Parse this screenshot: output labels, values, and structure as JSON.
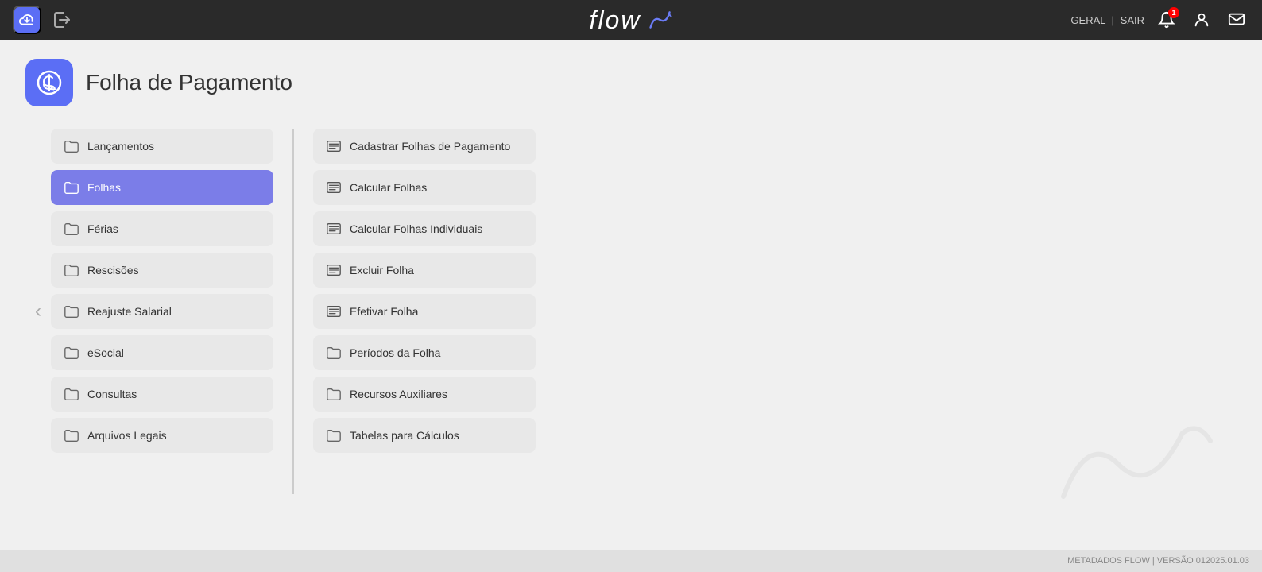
{
  "app": {
    "title": "flow",
    "brand_icon": "flow-icon"
  },
  "topnav": {
    "links": {
      "geral": "GERAL",
      "separator": "|",
      "sair": "SAIR"
    },
    "notif_count": "1"
  },
  "page": {
    "title": "Folha de Pagamento"
  },
  "col1": {
    "items": [
      {
        "id": "lancamentos",
        "label": "Lançamentos",
        "icon": "folder",
        "active": false
      },
      {
        "id": "folhas",
        "label": "Folhas",
        "icon": "folder",
        "active": true
      },
      {
        "id": "ferias",
        "label": "Férias",
        "icon": "folder",
        "active": false
      },
      {
        "id": "rescisoes",
        "label": "Rescisões",
        "icon": "folder",
        "active": false
      },
      {
        "id": "reajuste-salarial",
        "label": "Reajuste Salarial",
        "icon": "folder",
        "active": false
      },
      {
        "id": "esocial",
        "label": "eSocial",
        "icon": "folder",
        "active": false
      },
      {
        "id": "consultas",
        "label": "Consultas",
        "icon": "folder",
        "active": false
      },
      {
        "id": "arquivos-legais",
        "label": "Arquivos Legais",
        "icon": "folder",
        "active": false
      }
    ]
  },
  "col2": {
    "items": [
      {
        "id": "cadastrar-folhas",
        "label": "Cadastrar Folhas de Pagamento",
        "icon": "list"
      },
      {
        "id": "calcular-folhas",
        "label": "Calcular Folhas",
        "icon": "list"
      },
      {
        "id": "calcular-folhas-ind",
        "label": "Calcular Folhas Individuais",
        "icon": "list"
      },
      {
        "id": "excluir-folha",
        "label": "Excluir Folha",
        "icon": "list"
      },
      {
        "id": "efetivar-folha",
        "label": "Efetivar Folha",
        "icon": "list"
      },
      {
        "id": "periodos-folha",
        "label": "Períodos da Folha",
        "icon": "folder"
      },
      {
        "id": "recursos-auxiliares",
        "label": "Recursos Auxiliares",
        "icon": "folder"
      },
      {
        "id": "tabelas-calculos",
        "label": "Tabelas para Cálculos",
        "icon": "folder"
      }
    ]
  },
  "footer": {
    "text": "METADADOS FLOW | VERSÃO 012025.01.03"
  }
}
